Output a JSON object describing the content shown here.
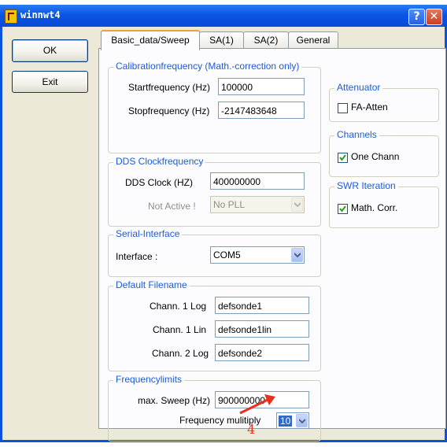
{
  "window": {
    "title": "winnwt4"
  },
  "buttons": {
    "ok": "OK",
    "exit": "Exit"
  },
  "tabs": [
    "Basic_data/Sweep",
    "SA(1)",
    "SA(2)",
    "General"
  ],
  "calibration": {
    "title": "Calibrationfrequency (Math.-correction only)",
    "start_label": "Startfrequency (Hz)",
    "start_value": "100000",
    "stop_label": "Stopfrequency (Hz)",
    "stop_value": "-2147483648"
  },
  "dds": {
    "title": "DDS Clockfrequency",
    "clock_label": "DDS Clock (HZ)",
    "clock_value": "400000000",
    "pll_label": "Not Active !",
    "pll_value": "No PLL"
  },
  "serial": {
    "title": "Serial-Interface",
    "interface_label": "Interface :",
    "interface_value": "COM5"
  },
  "filename": {
    "title": "Default Filename",
    "rows": [
      {
        "label": "Chann. 1  Log",
        "value": "defsonde1"
      },
      {
        "label": "Chann. 1  Lin",
        "value": "defsonde1lin"
      },
      {
        "label": "Chann. 2 Log",
        "value": "defsonde2"
      }
    ]
  },
  "limits": {
    "title": "Frequencylimits",
    "sweep_label": "max. Sweep (Hz)",
    "sweep_value": "900000000",
    "multiply_label": "Frequency mulitiply",
    "multiply_value": "10"
  },
  "attenuator": {
    "title": "Attenuator",
    "checkbox_label": "FA-Atten",
    "checked": false
  },
  "channels": {
    "title": "Channels",
    "checkbox_label": "One Chann",
    "checked": true
  },
  "swr": {
    "title": "SWR Iteration",
    "checkbox_label": "Math. Corr.",
    "checked": true
  },
  "annotation": {
    "number": "4",
    "color": "#e8301c"
  }
}
